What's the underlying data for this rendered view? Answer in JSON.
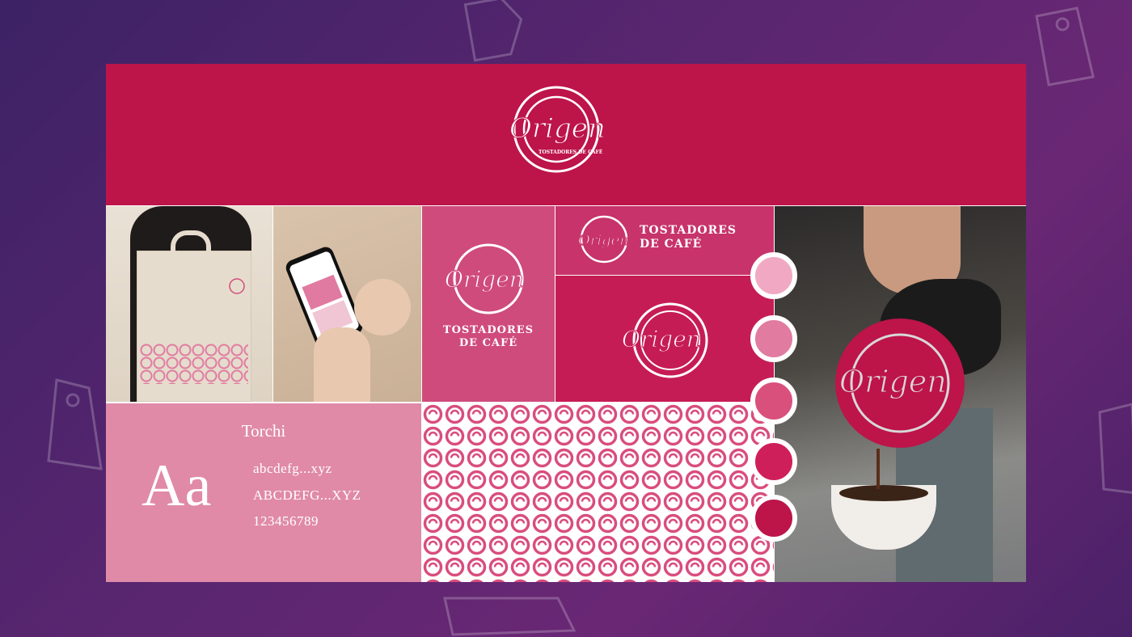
{
  "brand": {
    "wordmark": "Origen",
    "tagline": "TOSTADORES DE CAFÉ",
    "tagline_line1": "TOSTADORES",
    "tagline_line2": "DE CAFÉ"
  },
  "typography": {
    "font_name": "Torchi",
    "sample_big": "Aa",
    "lowercase": "abcdefg...xyz",
    "uppercase": "ABCDEFG...XYZ",
    "numbers": "123456789"
  },
  "palette": [
    "#f1a9c3",
    "#e17b9f",
    "#d9507d",
    "#cf1f5b",
    "#bd144a"
  ],
  "colors": {
    "primary": "#bd144a",
    "secondary": "#cf4b7b",
    "light": "#e08aa8",
    "background": "#5b2670"
  },
  "icons": [
    "price-tag-icon"
  ]
}
